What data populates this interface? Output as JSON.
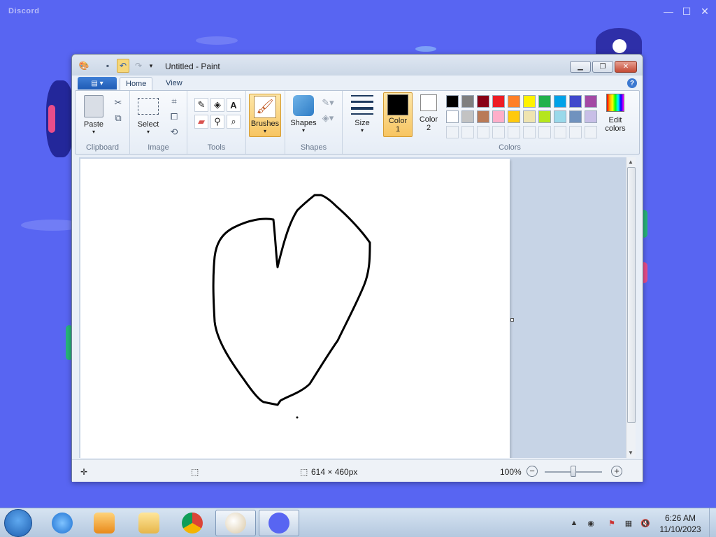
{
  "discord": {
    "title": "Discord",
    "min": "—",
    "max": "☐",
    "close": "✕"
  },
  "window": {
    "title": "Untitled - Paint"
  },
  "tabs": {
    "home": "Home",
    "view": "View",
    "help": "?"
  },
  "ribbon": {
    "clipboard": {
      "label": "Clipboard",
      "paste": "Paste"
    },
    "image": {
      "label": "Image",
      "select": "Select"
    },
    "tools": {
      "label": "Tools"
    },
    "brushes": "Brushes",
    "shapes": {
      "label": "Shapes",
      "button": "Shapes"
    },
    "size": "Size",
    "colors": {
      "label": "Colors",
      "color1": "Color 1",
      "color2": "Color 2",
      "edit": "Edit colors",
      "color1_value": "#000000",
      "color2_value": "#ffffff",
      "palette_row1": [
        "#000000",
        "#7f7f7f",
        "#880015",
        "#ed1c24",
        "#ff7f27",
        "#fff200",
        "#22b14c",
        "#00a2e8",
        "#3f48cc",
        "#a349a4"
      ],
      "palette_row2": [
        "#ffffff",
        "#c3c3c3",
        "#b97a57",
        "#ffaec9",
        "#ffc90e",
        "#efe4b0",
        "#b5e61d",
        "#99d9ea",
        "#7092be",
        "#c8bfe7"
      ]
    }
  },
  "status": {
    "dimensions": "614 × 460px",
    "zoom": "100%"
  },
  "taskbar": {
    "time": "6:26 AM",
    "date": "11/10/2023"
  }
}
